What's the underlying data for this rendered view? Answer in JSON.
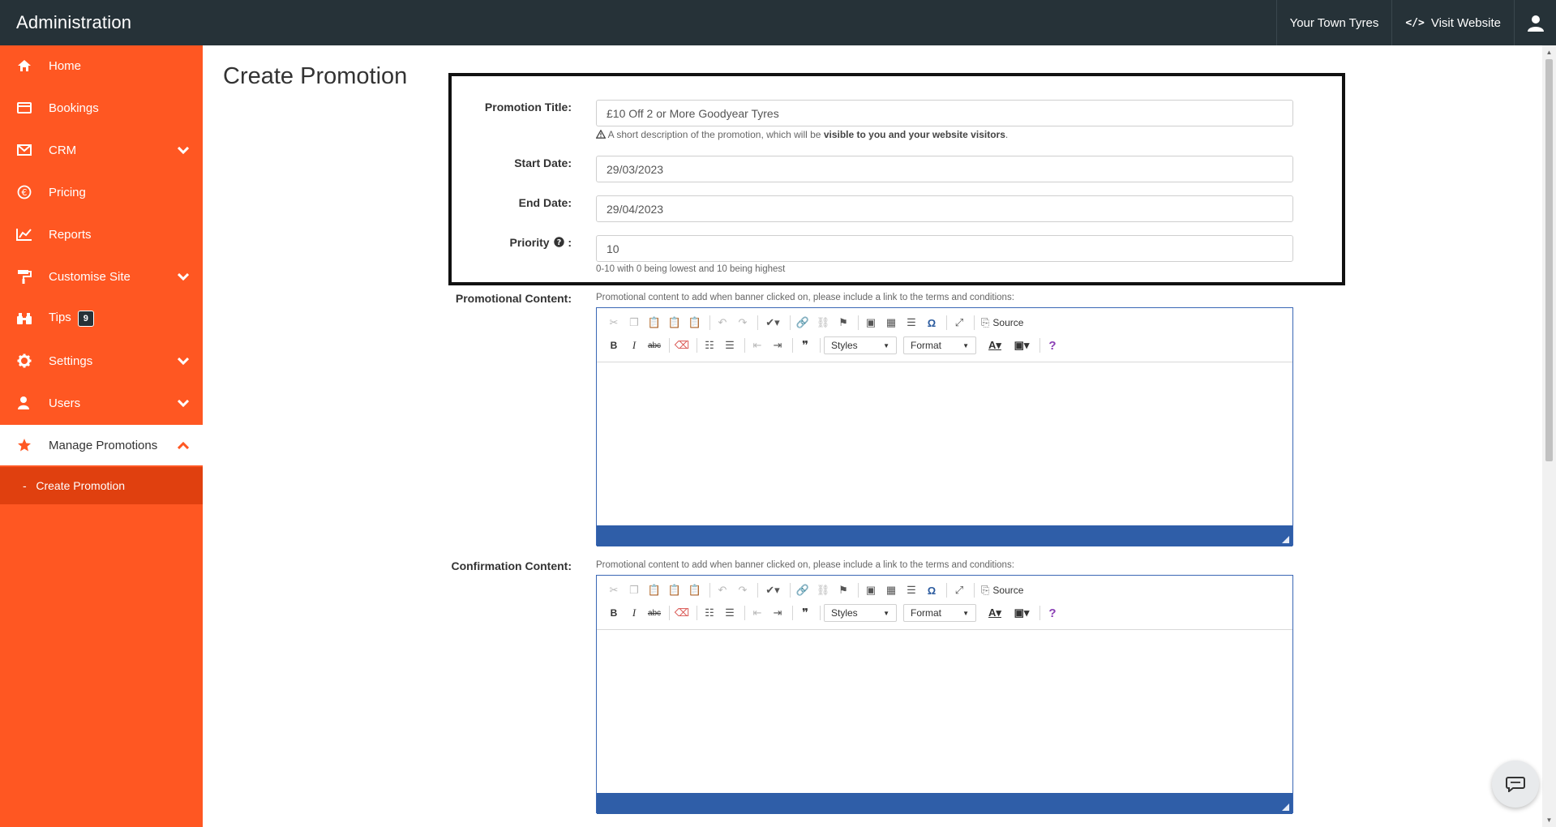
{
  "header": {
    "title": "Administration",
    "site_name": "Your Town Tyres",
    "visit_website": "Visit Website"
  },
  "sidebar": {
    "items": [
      {
        "label": "Home",
        "icon": "home-icon"
      },
      {
        "label": "Bookings",
        "icon": "credit-card-icon"
      },
      {
        "label": "CRM",
        "icon": "envelope-icon"
      },
      {
        "label": "Pricing",
        "icon": "euro-icon"
      },
      {
        "label": "Reports",
        "icon": "line-chart-icon"
      },
      {
        "label": "Customise Site",
        "icon": "paint-roller-icon"
      },
      {
        "label": "Tips",
        "icon": "binoculars-icon",
        "badge": "9"
      },
      {
        "label": "Settings",
        "icon": "gear-icon"
      },
      {
        "label": "Users",
        "icon": "user-icon"
      },
      {
        "label": "Manage Promotions",
        "icon": "star-icon"
      }
    ],
    "sub_item": {
      "prefix": "-",
      "label": "Create Promotion"
    }
  },
  "page": {
    "title": "Create Promotion"
  },
  "form": {
    "promotion_title": {
      "label": "Promotion Title:",
      "value": "£10 Off 2 or More Goodyear Tyres",
      "help_prefix": "A short description of the promotion, which will be ",
      "help_bold": "visible to you and your website visitors",
      "help_suffix": "."
    },
    "start_date": {
      "label": "Start Date:",
      "value": "29/03/2023"
    },
    "end_date": {
      "label": "End Date:",
      "value": "29/04/2023"
    },
    "priority": {
      "label": "Priority",
      "label_suffix": ":",
      "value": "10",
      "help": "0-10 with 0 being lowest and 10 being highest"
    },
    "promotional_content": {
      "label": "Promotional Content:",
      "help": "Promotional content to add when banner clicked on, please include a link to the terms and conditions:"
    },
    "confirmation_content": {
      "label": "Confirmation Content:",
      "help": "Promotional content to add when banner clicked on, please include a link to the terms and conditions:"
    }
  },
  "editor_toolbar": {
    "source": "Source",
    "styles": "Styles",
    "format": "Format",
    "bold": "B",
    "italic": "I",
    "strike": "abc",
    "help": "?",
    "quote": "❞",
    "special_char": "Ω"
  },
  "colors": {
    "sidebar_bg": "#ff5722",
    "topbar_bg": "#263238",
    "editor_footer": "#2f5ea8"
  }
}
